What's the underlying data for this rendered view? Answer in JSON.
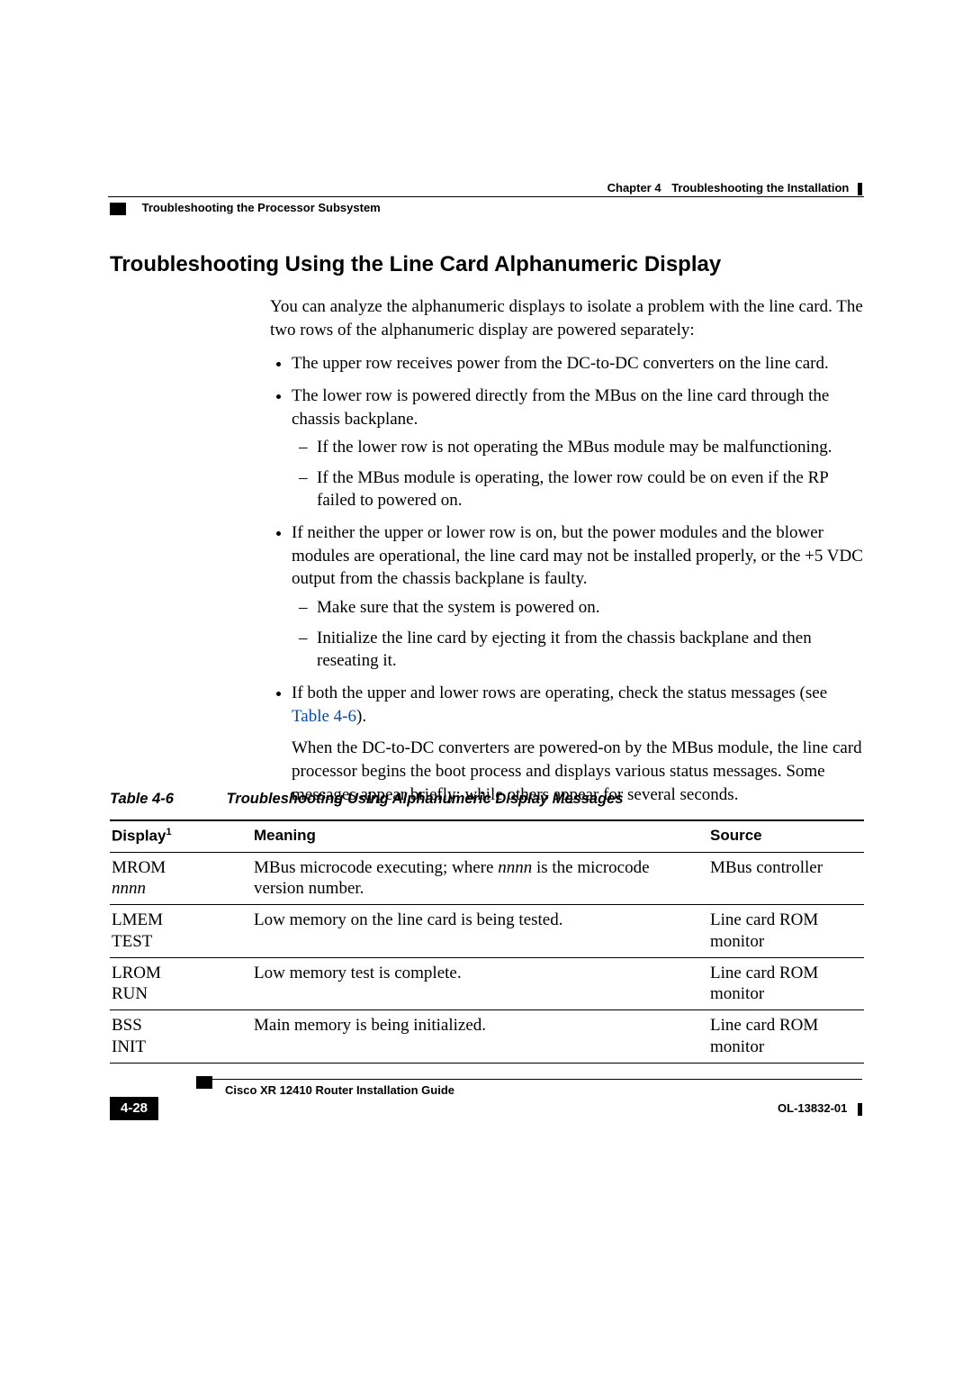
{
  "header": {
    "chapter_label": "Chapter 4",
    "chapter_title": "Troubleshooting the Installation",
    "section_running": "Troubleshooting the Processor Subsystem"
  },
  "heading": "Troubleshooting Using the Line Card Alphanumeric Display",
  "intro": "You can analyze the alphanumeric displays to isolate a problem with the line card. The two rows of the alphanumeric display are powered separately:",
  "bullets": {
    "b0": "The upper row receives power from the DC-to-DC converters on the line card.",
    "b1": "The lower row is powered directly from the MBus on the line card through the chassis backplane.",
    "b1a": "If the lower row is not operating the MBus module may be malfunctioning.",
    "b1b": "If the MBus module is operating, the lower row could be on even if the RP failed to powered on.",
    "b2": "If neither the upper or lower row is on, but the power modules and the blower modules are operational, the line card may not be installed properly, or the +5 VDC output from the chassis backplane is faulty.",
    "b2a": "Make sure that the system is powered on.",
    "b2b": "Initialize the line card by ejecting it from the chassis backplane and then reseating it.",
    "b3a": "If both the upper and lower rows are operating, check the status messages (see ",
    "b3link": "Table 4-6",
    "b3b": ").",
    "b3para": "When the DC-to-DC converters are powered-on by the MBus module, the line card processor begins the boot process and displays various status messages. Some messages appear briefly; while others appear for several seconds."
  },
  "table": {
    "caption_num": "Table 4-6",
    "caption_txt": "Troubleshooting Using Alphanumeric Display Messages",
    "head": {
      "c1": "Display",
      "c1sup": "1",
      "c2": "Meaning",
      "c3": "Source"
    },
    "rows": [
      {
        "d1": "MROM",
        "d1b": "nnnn",
        "m_a": "MBus microcode executing; where ",
        "m_i": "nnnn",
        "m_b": " is the microcode version number.",
        "s": "MBus controller"
      },
      {
        "d1": "LMEM",
        "d1b": "TEST",
        "m": "Low memory on the line card is being tested.",
        "s": "Line card ROM monitor"
      },
      {
        "d1": "LROM",
        "d1b": "RUN",
        "m": "Low memory test is complete.",
        "s": "Line card ROM monitor"
      },
      {
        "d1": "BSS",
        "d1b": "INIT",
        "m": "Main memory is being initialized.",
        "s": "Line card ROM monitor"
      }
    ]
  },
  "footer": {
    "guide": "Cisco XR 12410 Router Installation Guide",
    "page": "4-28",
    "docid": "OL-13832-01"
  }
}
